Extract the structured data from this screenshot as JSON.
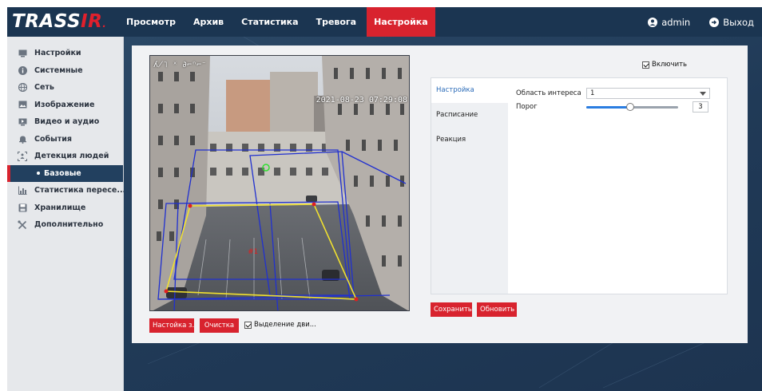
{
  "app": {
    "logo_text": "TRASSIR",
    "logo_red_part": "IR"
  },
  "nav": {
    "items": [
      "Просмотр",
      "Архив",
      "Статистика",
      "Тревога",
      "Настройка"
    ],
    "active": "Настройка",
    "user": "admin",
    "logout": "Выход"
  },
  "sidebar": {
    "items": [
      {
        "label": "Настройки",
        "icon": "monitor-icon"
      },
      {
        "label": "Системные",
        "icon": "info-icon"
      },
      {
        "label": "Сеть",
        "icon": "globe-icon"
      },
      {
        "label": "Изображение",
        "icon": "image-icon"
      },
      {
        "label": "Видео и аудио",
        "icon": "video-icon"
      },
      {
        "label": "События",
        "icon": "bell-icon"
      },
      {
        "label": "Детекция людей",
        "icon": "person-detect-icon"
      },
      {
        "label": "Базовые",
        "icon": "",
        "active": true
      },
      {
        "label": "Статистика пересе...",
        "icon": "bar-chart-icon"
      },
      {
        "label": "Хранилище",
        "icon": "disk-icon"
      },
      {
        "label": "Дополнительно",
        "icon": "tools-icon"
      }
    ]
  },
  "video": {
    "timestamp": "2021-08-23 07:29:08",
    "zone_label": "#1"
  },
  "video_controls": {
    "config_button": "Настойка з...",
    "clear_button": "Очистка",
    "motion_checkbox": "Выделение дви...",
    "motion_checked": true
  },
  "settings": {
    "enable_label": "Включить",
    "enabled": true,
    "tabs": [
      "Настройка",
      "Расписание",
      "Реакция"
    ],
    "active_tab": "Настройка",
    "roi_label": "Область интереса",
    "roi_value": "1",
    "threshold_label": "Порог",
    "threshold_value": "3",
    "threshold_fraction": 0.48,
    "save_button": "Сохранить",
    "refresh_button": "Обновить"
  },
  "colors": {
    "accent": "#d8232e",
    "nav_bg": "#1b3551",
    "link": "#2a6bb8"
  }
}
